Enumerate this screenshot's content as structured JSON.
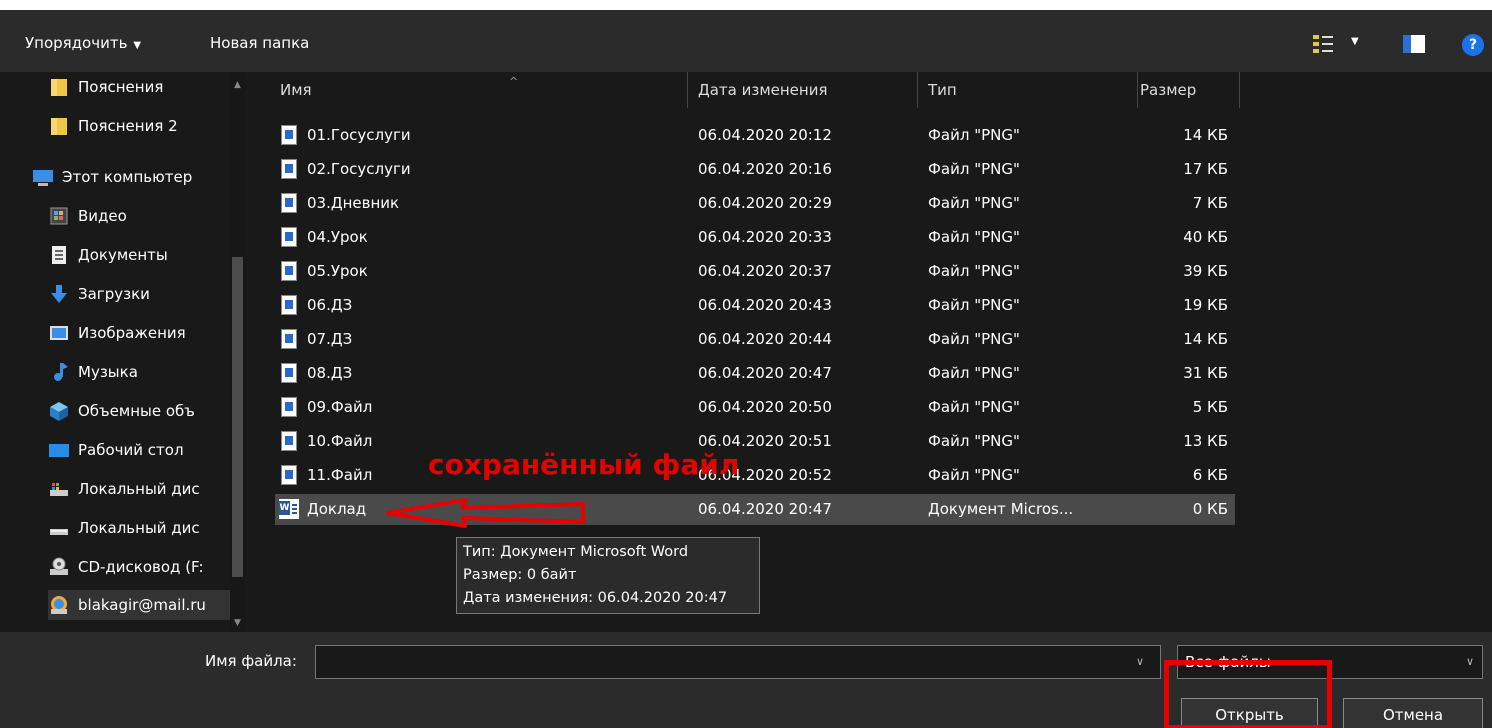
{
  "toolbar": {
    "organize_label": "Упорядочить",
    "new_folder_label": "Новая папка"
  },
  "sidebar": {
    "items": [
      {
        "label": "Пояснения",
        "icon": "folder-icon"
      },
      {
        "label": "Пояснения 2",
        "icon": "folder-icon"
      },
      {
        "label": "Этот компьютер",
        "icon": "computer-icon"
      },
      {
        "label": "Видео",
        "icon": "video-icon"
      },
      {
        "label": "Документы",
        "icon": "documents-icon"
      },
      {
        "label": "Загрузки",
        "icon": "download-icon"
      },
      {
        "label": "Изображения",
        "icon": "pictures-icon"
      },
      {
        "label": "Музыка",
        "icon": "music-icon"
      },
      {
        "label": "Объемные объ",
        "icon": "3d-objects-icon"
      },
      {
        "label": "Рабочий стол",
        "icon": "desktop-icon"
      },
      {
        "label": "Локальный дис",
        "icon": "drive-icon"
      },
      {
        "label": "Локальный дис",
        "icon": "drive-icon"
      },
      {
        "label": "CD-дисковод (F:",
        "icon": "cd-drive-icon"
      },
      {
        "label": "blakagir@mail.ru",
        "icon": "network-drive-icon"
      }
    ]
  },
  "table": {
    "headers": {
      "name": "Имя",
      "date": "Дата изменения",
      "type": "Тип",
      "size": "Размер"
    },
    "rows": [
      {
        "name": "01.Госуслуги",
        "date": "06.04.2020 20:12",
        "type": "Файл \"PNG\"",
        "size": "14 КБ"
      },
      {
        "name": "02.Госуслуги",
        "date": "06.04.2020 20:16",
        "type": "Файл \"PNG\"",
        "size": "17 КБ"
      },
      {
        "name": "03.Дневник",
        "date": "06.04.2020 20:29",
        "type": "Файл \"PNG\"",
        "size": "7 КБ"
      },
      {
        "name": "04.Урок",
        "date": "06.04.2020 20:33",
        "type": "Файл \"PNG\"",
        "size": "40 КБ"
      },
      {
        "name": "05.Урок",
        "date": "06.04.2020 20:37",
        "type": "Файл \"PNG\"",
        "size": "39 КБ"
      },
      {
        "name": "06.ДЗ",
        "date": "06.04.2020 20:43",
        "type": "Файл \"PNG\"",
        "size": "19 КБ"
      },
      {
        "name": "07.ДЗ",
        "date": "06.04.2020 20:44",
        "type": "Файл \"PNG\"",
        "size": "14 КБ"
      },
      {
        "name": "08.ДЗ",
        "date": "06.04.2020 20:47",
        "type": "Файл \"PNG\"",
        "size": "31 КБ"
      },
      {
        "name": "09.Файл",
        "date": "06.04.2020 20:50",
        "type": "Файл \"PNG\"",
        "size": "5 КБ"
      },
      {
        "name": "10.Файл",
        "date": "06.04.2020 20:51",
        "type": "Файл \"PNG\"",
        "size": "13 КБ"
      },
      {
        "name": "11.Файл",
        "date": "06.04.2020 20:52",
        "type": "Файл \"PNG\"",
        "size": "6 КБ"
      },
      {
        "name": "Доклад",
        "date": "06.04.2020 20:47",
        "type": "Документ Micros...",
        "size": "0 КБ"
      }
    ]
  },
  "annotation": {
    "text": "сохранённый файл",
    "color": "#e60000"
  },
  "tooltip": {
    "line1": "Тип: Документ Microsoft Word",
    "line2": "Размер: 0 байт",
    "line3": "Дата изменения: 06.04.2020 20:47"
  },
  "bottom": {
    "filename_label": "Имя файла:",
    "filename_value": "",
    "filter_value": "Все файлы",
    "open_label": "Открыть",
    "cancel_label": "Отмена"
  }
}
